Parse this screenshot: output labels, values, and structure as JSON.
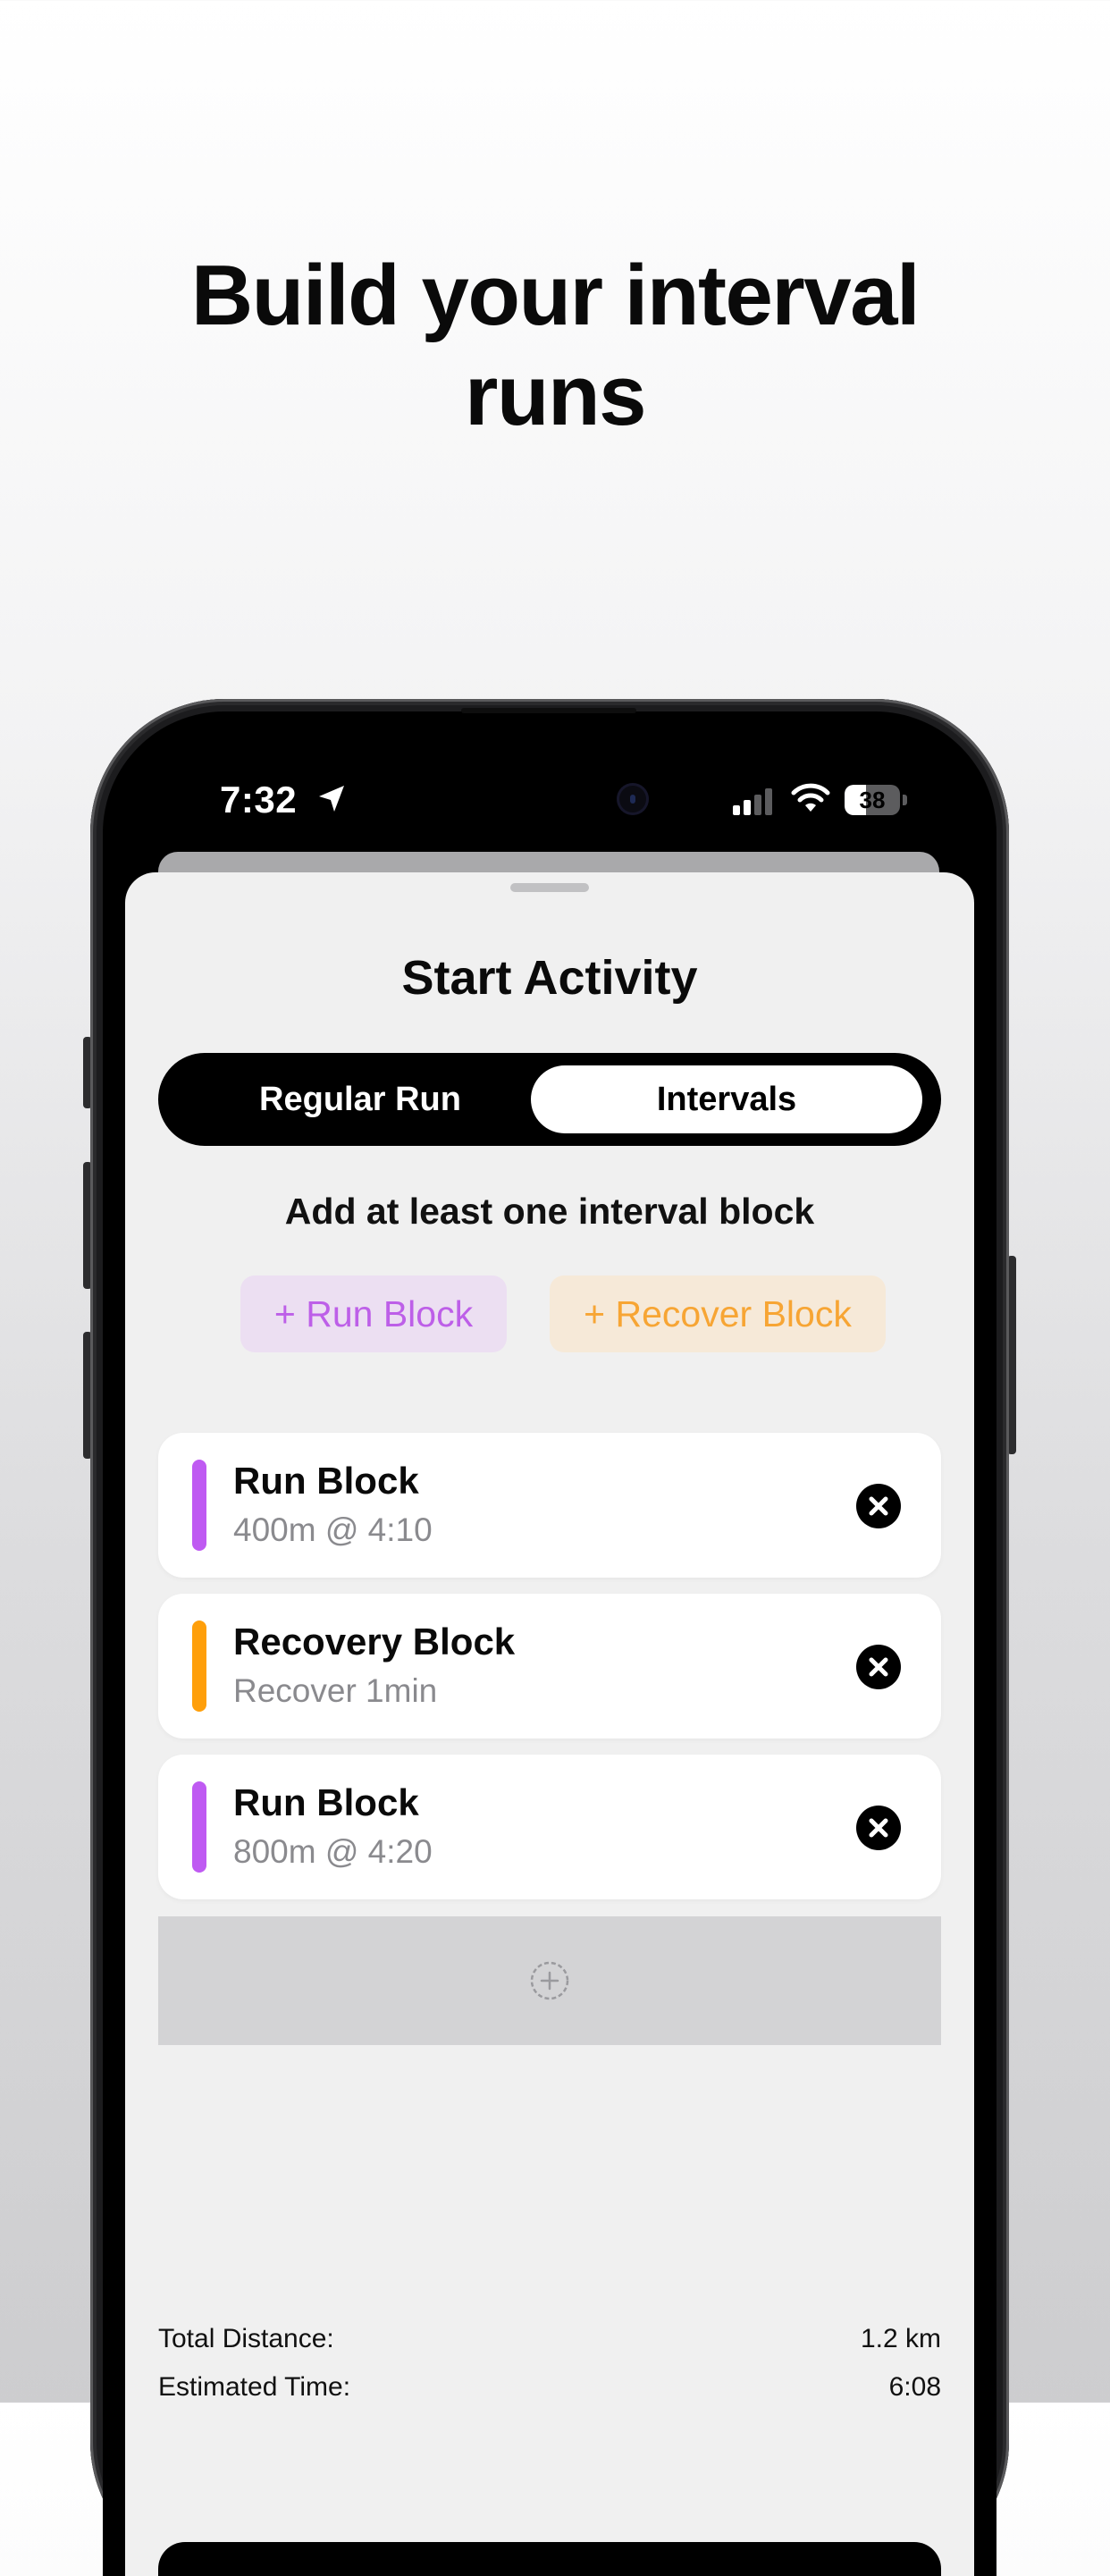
{
  "headline": {
    "line1": "Build your interval",
    "line2": "runs"
  },
  "status_bar": {
    "time": "7:32",
    "battery": "38",
    "battery_level": 0.38,
    "icons": [
      "location-arrow-icon",
      "cellular-signal-icon",
      "wifi-icon",
      "battery-icon"
    ]
  },
  "sheet": {
    "title": "Start Activity",
    "segments": [
      {
        "label": "Regular Run",
        "selected": false
      },
      {
        "label": "Intervals",
        "selected": true
      }
    ],
    "hint": "Add at least one interval block",
    "add_buttons": {
      "run": "+ Run Block",
      "recover": "+ Recover Block"
    },
    "blocks": [
      {
        "title": "Run Block",
        "subtitle": "400m @ 4:10",
        "accent": "#bf5af2"
      },
      {
        "title": "Recovery Block",
        "subtitle": "Recover 1min",
        "accent": "#ff9f0a"
      },
      {
        "title": "Run Block",
        "subtitle": "800m @ 4:20",
        "accent": "#bf5af2"
      }
    ],
    "summary": {
      "distance_label": "Total Distance:",
      "distance_value": "1.2 km",
      "time_label": "Estimated Time:",
      "time_value": "6:08"
    }
  },
  "colors": {
    "run_accent": "#bf5af2",
    "recover_accent": "#ff9f0a",
    "sheet_bg": "#f0f0f0"
  }
}
